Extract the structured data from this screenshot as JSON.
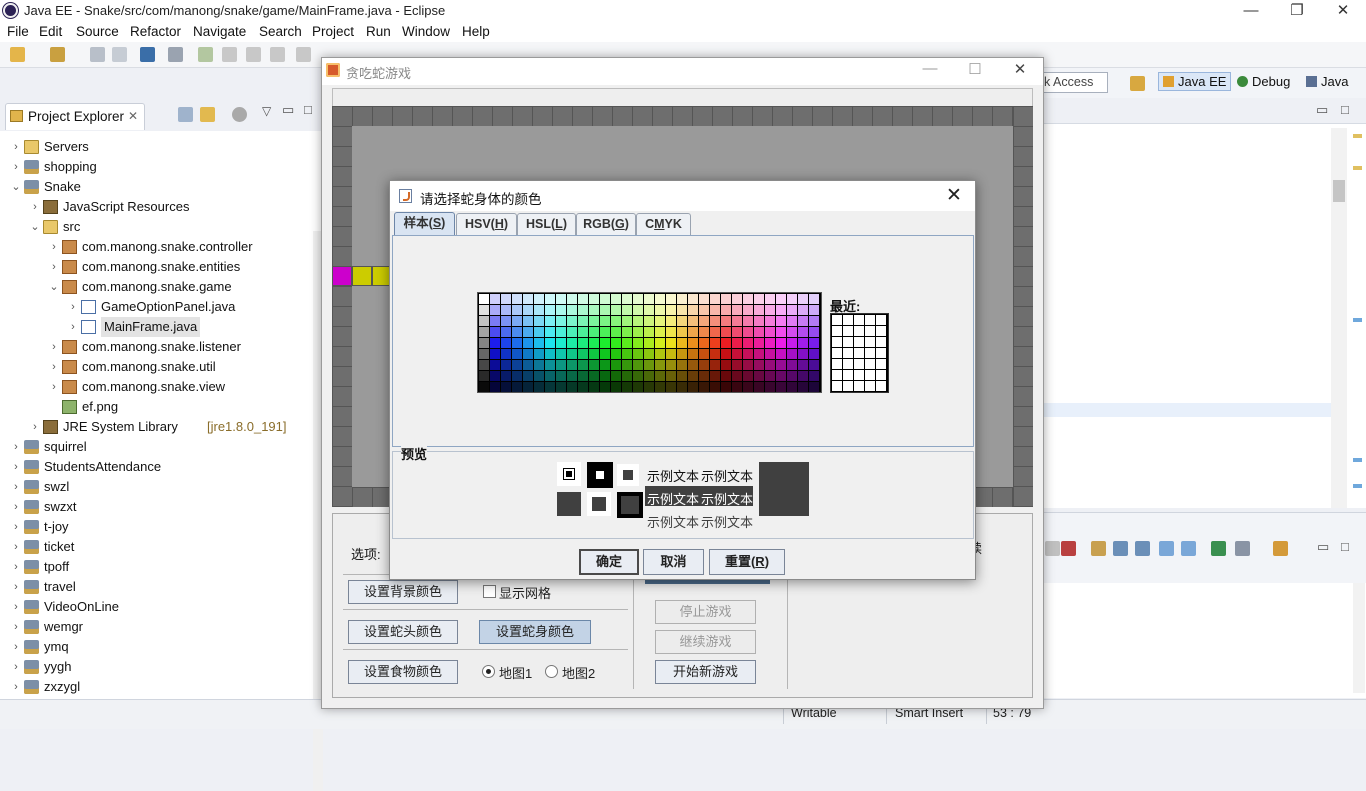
{
  "eclipse": {
    "window_title": "Java EE - Snake/src/com/manong/snake/game/MainFrame.java - Eclipse",
    "menu": [
      "File",
      "Edit",
      "Source",
      "Refactor",
      "Navigate",
      "Search",
      "Project",
      "Run",
      "Window",
      "Help"
    ],
    "quick_access": "k Access",
    "perspectives": [
      "Java EE",
      "Debug",
      "Java"
    ],
    "project_explorer": {
      "tab_label": "Project Explorer",
      "tree": [
        {
          "label": "Servers",
          "depth": 1,
          "toggle": "›",
          "icon": "folder"
        },
        {
          "label": "shopping",
          "depth": 1,
          "toggle": "›",
          "icon": "project"
        },
        {
          "label": "Snake",
          "depth": 1,
          "toggle": "⌄",
          "icon": "project"
        },
        {
          "label": "JavaScript Resources",
          "depth": 2,
          "toggle": "›",
          "icon": "lib"
        },
        {
          "label": "src",
          "depth": 2,
          "toggle": "⌄",
          "icon": "folder"
        },
        {
          "label": "com.manong.snake.controller",
          "depth": 3,
          "toggle": "›",
          "icon": "package"
        },
        {
          "label": "com.manong.snake.entities",
          "depth": 3,
          "toggle": "›",
          "icon": "package"
        },
        {
          "label": "com.manong.snake.game",
          "depth": 3,
          "toggle": "⌄",
          "icon": "package"
        },
        {
          "label": "GameOptionPanel.java",
          "depth": 4,
          "toggle": "›",
          "icon": "java"
        },
        {
          "label": "MainFrame.java",
          "depth": 4,
          "toggle": "›",
          "icon": "java",
          "selected": true
        },
        {
          "label": "com.manong.snake.listener",
          "depth": 3,
          "toggle": "›",
          "icon": "package"
        },
        {
          "label": "com.manong.snake.util",
          "depth": 3,
          "toggle": "›",
          "icon": "package"
        },
        {
          "label": "com.manong.snake.view",
          "depth": 3,
          "toggle": "›",
          "icon": "package"
        },
        {
          "label": "ef.png",
          "depth": 3,
          "toggle": "",
          "icon": "image"
        },
        {
          "label": "JRE System Library",
          "sub": "[jre1.8.0_191]",
          "depth": 2,
          "toggle": "›",
          "icon": "lib"
        },
        {
          "label": "squirrel",
          "depth": 1,
          "toggle": "›",
          "icon": "project"
        },
        {
          "label": "StudentsAttendance",
          "depth": 1,
          "toggle": "›",
          "icon": "project"
        },
        {
          "label": "swzl",
          "depth": 1,
          "toggle": "›",
          "icon": "project"
        },
        {
          "label": "swzxt",
          "depth": 1,
          "toggle": "›",
          "icon": "project"
        },
        {
          "label": "t-joy",
          "depth": 1,
          "toggle": "›",
          "icon": "project"
        },
        {
          "label": "ticket",
          "depth": 1,
          "toggle": "›",
          "icon": "project"
        },
        {
          "label": "tpoff",
          "depth": 1,
          "toggle": "›",
          "icon": "project"
        },
        {
          "label": "travel",
          "depth": 1,
          "toggle": "›",
          "icon": "project"
        },
        {
          "label": "VideoOnLine",
          "depth": 1,
          "toggle": "›",
          "icon": "project"
        },
        {
          "label": "wemgr",
          "depth": 1,
          "toggle": "›",
          "icon": "project"
        },
        {
          "label": "ymq",
          "depth": 1,
          "toggle": "›",
          "icon": "project"
        },
        {
          "label": "yygh",
          "depth": 1,
          "toggle": "›",
          "icon": "project"
        },
        {
          "label": "zxzygl",
          "depth": 1,
          "toggle": "›",
          "icon": "project"
        }
      ]
    },
    "status": {
      "writable": "Writable",
      "insert_mode": "Smart Insert",
      "cursor": "53 : 79"
    }
  },
  "game": {
    "title": "贪吃蛇游戏",
    "snake_colors": {
      "head": "#cc00cc",
      "body": "#cccc00"
    },
    "options_label": "选项:",
    "buttons": {
      "bg_color": "设置背景颜色",
      "head_color": "设置蛇头颜色",
      "body_color": "设置蛇身颜色",
      "food_color": "设置食物颜色",
      "stop": "停止游戏",
      "resume": "继续游戏",
      "new_game": "开始新游戏"
    },
    "show_grid": "显示网格",
    "map1": "地图1",
    "map2": "地图2",
    "partial_text": "续"
  },
  "color_dialog": {
    "title": "请选择蛇身体的颜色",
    "tabs": [
      {
        "text": "样本(",
        "mn": "S",
        "end": ")"
      },
      {
        "text": "HSV(",
        "mn": "H",
        "end": ")"
      },
      {
        "text": "HSL(",
        "mn": "L",
        "end": ")"
      },
      {
        "text": "RGB(",
        "mn": "G",
        "end": ")"
      },
      {
        "text": "C",
        "mn": "M",
        "end": "YK"
      }
    ],
    "recent_label": "最近:",
    "preview_label": "预览",
    "sample_text": "示例文本",
    "preview_color": "#404040",
    "buttons": {
      "ok": "确定",
      "cancel": "取消",
      "reset_text": "重置(",
      "reset_mn": "R",
      "reset_end": ")"
    }
  }
}
